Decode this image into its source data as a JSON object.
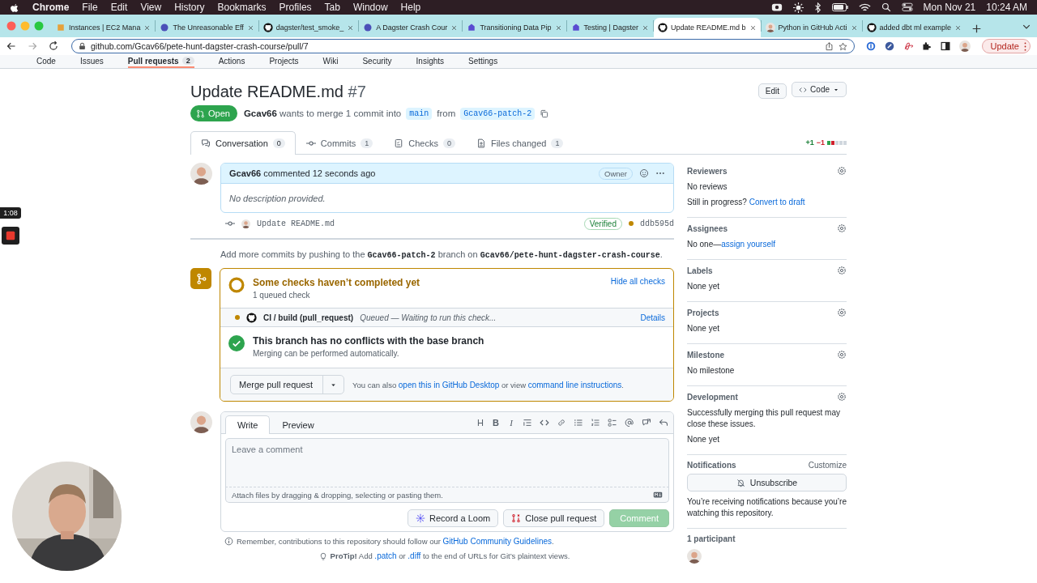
{
  "menubar": {
    "app": "Chrome",
    "menus": [
      "File",
      "Edit",
      "View",
      "History",
      "Bookmarks",
      "Profiles",
      "Tab",
      "Window",
      "Help"
    ],
    "date": "Mon Nov 21",
    "time": "10:24 AM"
  },
  "browser": {
    "tabs": [
      {
        "title": "Instances | EC2 Mana",
        "selected": false
      },
      {
        "title": "The Unreasonable Eff",
        "selected": false
      },
      {
        "title": "dagster/test_smoke_",
        "selected": false
      },
      {
        "title": "A Dagster Crash Cour",
        "selected": false
      },
      {
        "title": "Transitioning Data Pip",
        "selected": false
      },
      {
        "title": "Testing | Dagster",
        "selected": false
      },
      {
        "title": "Update README.md b",
        "selected": true
      },
      {
        "title": "Python in GitHub Acti",
        "selected": false
      },
      {
        "title": "added dbt ml example",
        "selected": false
      }
    ],
    "url": "github.com/Gcav66/pete-hunt-dagster-crash-course/pull/7",
    "update": "Update"
  },
  "repo_nav": [
    {
      "label": "Code",
      "selected": false
    },
    {
      "label": "Issues",
      "selected": false
    },
    {
      "label": "Pull requests",
      "count": "2",
      "selected": true
    },
    {
      "label": "Actions",
      "selected": false
    },
    {
      "label": "Projects",
      "selected": false
    },
    {
      "label": "Wiki",
      "selected": false
    },
    {
      "label": "Security",
      "selected": false
    },
    {
      "label": "Insights",
      "selected": false
    },
    {
      "label": "Settings",
      "selected": false
    }
  ],
  "pr": {
    "title": "Update README.md",
    "number": "#7",
    "state": "Open",
    "author": "Gcav66",
    "merge_text": "wants to merge 1 commit into",
    "base": "main",
    "from_word": "from",
    "head": "Gcav66-patch-2",
    "header_buttons": [
      "Edit",
      "Code"
    ],
    "tabs": [
      {
        "label": "Conversation",
        "count": "0",
        "selected": true
      },
      {
        "label": "Commits",
        "count": "1",
        "selected": false
      },
      {
        "label": "Checks",
        "count": "0",
        "selected": false
      },
      {
        "label": "Files changed",
        "count": "1",
        "selected": false
      }
    ],
    "diffstat": {
      "added": "+1",
      "removed": "−1"
    }
  },
  "comment": {
    "author": "Gcav66",
    "action": "commented 12 seconds ago",
    "role": "Owner",
    "body": "No description provided."
  },
  "commit": {
    "message": "Update README.md",
    "badge": "Verified",
    "sha": "ddb595d"
  },
  "push_hint": "Add more commits by pushing to the **Gcav66-patch-2** branch on **Gcav66/pete-hunt-dagster-crash-course**.",
  "merge_box": {
    "checks_title": "Some checks haven’t completed yet",
    "checks_sub": "1 queued check",
    "hide_link": "Hide all checks",
    "check": {
      "name": "CI / build (pull_request)",
      "status": "Queued — Waiting to run this check...",
      "details": "Details"
    },
    "conflicts_title": "This branch has no conflicts with the base branch",
    "conflicts_sub": "Merging can be performed automatically.",
    "merge_button": "Merge pull request",
    "also": [
      {
        "kind": "text",
        "text": "You can also "
      },
      {
        "kind": "link",
        "text": "open this in GitHub Desktop"
      },
      {
        "kind": "text",
        "text": " or view "
      },
      {
        "kind": "link",
        "text": "command line instructions"
      },
      {
        "kind": "text",
        "text": "."
      }
    ]
  },
  "editor": {
    "tabs": [
      {
        "label": "Write",
        "selected": true
      },
      {
        "label": "Preview",
        "selected": false
      }
    ],
    "format_keys": [
      "H",
      "B",
      "I"
    ],
    "placeholder": "Leave a comment",
    "attach_hint": "Attach files by dragging & dropping, selecting or pasting them.",
    "buttons": [
      {
        "label": "Record a Loom",
        "kind": "loom",
        "disabled": false
      },
      {
        "label": "Close pull request",
        "kind": "close",
        "disabled": false
      },
      {
        "label": "Comment",
        "kind": "submit",
        "disabled": true
      }
    ]
  },
  "remember": [
    {
      "kind": "text",
      "text": "Remember, contributions to this repository should follow our "
    },
    {
      "kind": "link",
      "text": "GitHub Community Guidelines"
    },
    {
      "kind": "text",
      "text": "."
    }
  ],
  "protip": [
    {
      "kind": "bold",
      "text": "ProTip!"
    },
    {
      "kind": "text",
      "text": " Add "
    },
    {
      "kind": "link",
      "text": ".patch"
    },
    {
      "kind": "text",
      "text": " or "
    },
    {
      "kind": "link",
      "text": ".diff"
    },
    {
      "kind": "text",
      "text": " to the end of URLs for Git’s plaintext views."
    }
  ],
  "sidebar": [
    {
      "kind": "setting",
      "title": "Reviewers",
      "lines": [
        [
          {
            "kind": "text",
            "text": "No reviews"
          }
        ],
        [
          {
            "kind": "text",
            "text": "Still in progress? "
          },
          {
            "kind": "link",
            "text": "Convert to draft"
          }
        ]
      ]
    },
    {
      "kind": "setting",
      "title": "Assignees",
      "lines": [
        [
          {
            "kind": "text",
            "text": "No one—"
          },
          {
            "kind": "link",
            "text": "assign yourself"
          }
        ]
      ]
    },
    {
      "kind": "setting",
      "title": "Labels",
      "lines": [
        [
          {
            "kind": "text",
            "text": "None yet"
          }
        ]
      ]
    },
    {
      "kind": "setting",
      "title": "Projects",
      "lines": [
        [
          {
            "kind": "text",
            "text": "None yet"
          }
        ]
      ]
    },
    {
      "kind": "setting",
      "title": "Milestone",
      "lines": [
        [
          {
            "kind": "text",
            "text": "No milestone"
          }
        ]
      ]
    },
    {
      "kind": "setting",
      "title": "Development",
      "lines": [
        [
          {
            "kind": "text",
            "text": "Successfully merging this pull request may close these issues."
          }
        ],
        [
          {
            "kind": "text",
            "text": "None yet"
          }
        ]
      ]
    },
    {
      "kind": "notifications",
      "title": "Notifications",
      "action": "Customize",
      "button": "Unsubscribe",
      "lines": [
        [
          {
            "kind": "text",
            "text": "You’re receiving notifications because you’re watching this repository."
          }
        ]
      ]
    },
    {
      "kind": "participants",
      "title": "1 participant"
    }
  ],
  "recording": {
    "timer": "1:08"
  }
}
